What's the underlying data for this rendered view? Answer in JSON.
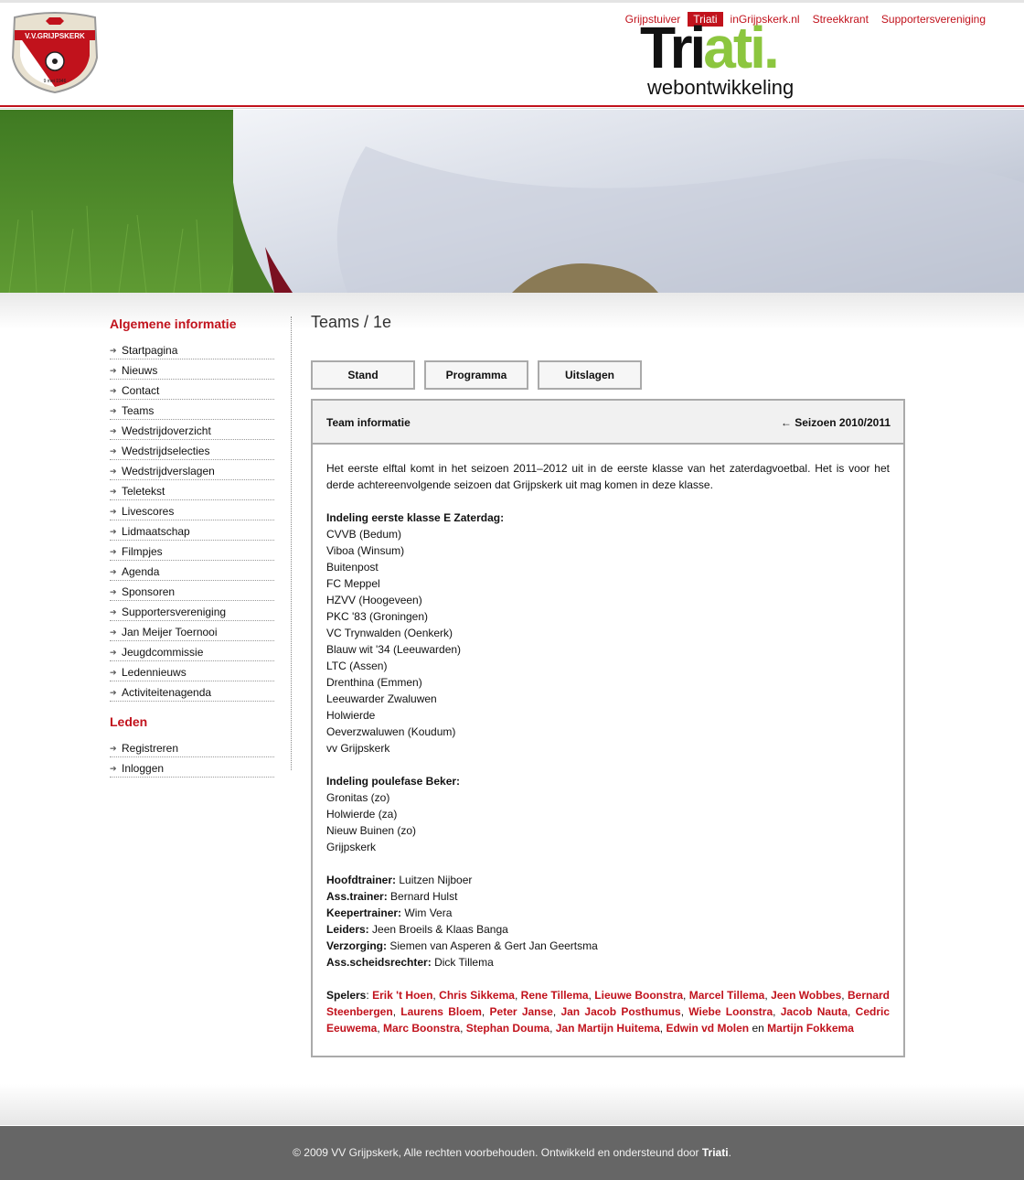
{
  "brand": {
    "club_name": "V.V.GRIJPSKERK",
    "founded": "9 mei 1946"
  },
  "topnav": [
    {
      "label": "Grijpstuiver",
      "active": false
    },
    {
      "label": "Triati",
      "active": true
    },
    {
      "label": "inGrijpskerk.nl",
      "active": false
    },
    {
      "label": "Streekkrant",
      "active": false
    },
    {
      "label": "Supportersvereniging",
      "active": false
    }
  ],
  "sponsor": {
    "name_part1": "Tri",
    "name_part2": "ati.",
    "tagline": "webontwikkeling"
  },
  "sidebar": {
    "section1_title": "Algemene informatie",
    "section1_items": [
      "Startpagina",
      "Nieuws",
      "Contact",
      "Teams",
      "Wedstrijdoverzicht",
      "Wedstrijdselecties",
      "Wedstrijdverslagen",
      "Teletekst",
      "Livescores",
      "Lidmaatschap",
      "Filmpjes",
      "Agenda",
      "Sponsoren",
      "Supportersvereniging",
      "Jan Meijer Toernooi",
      "Jeugdcommissie",
      "Ledennieuws",
      "Activiteitenagenda"
    ],
    "section2_title": "Leden",
    "section2_items": [
      "Registreren",
      "Inloggen"
    ]
  },
  "page_title": "Teams / 1e",
  "tabs": {
    "stand": "Stand",
    "programma": "Programma",
    "uitslagen": "Uitslagen"
  },
  "panel": {
    "header_label": "Team informatie",
    "season_link": "← Seizoen 2010/2011",
    "intro": "Het eerste elftal komt in het seizoen 2011–2012 uit in de eerste klasse van het zaterdagvoetbal. Het is voor het derde achtereenvolgende seizoen dat Grijpskerk uit mag komen in deze klasse.",
    "division_title": "Indeling eerste klasse E Zaterdag:",
    "division": [
      "CVVB (Bedum)",
      "Viboa (Winsum)",
      "Buitenpost",
      "FC Meppel",
      "HZVV (Hoogeveen)",
      "PKC '83 (Groningen)",
      "VC Trynwalden (Oenkerk)",
      "Blauw wit '34 (Leeuwarden)",
      "LTC (Assen)",
      "Drenthina (Emmen)",
      "Leeuwarder Zwaluwen",
      "Holwierde",
      "Oeverzwaluwen (Koudum)",
      "vv Grijpskerk"
    ],
    "cup_title": "Indeling poulefase Beker:",
    "cup": [
      "Gronitas (zo)",
      "Holwierde (za)",
      "Nieuw Buinen (zo)",
      "Grijpskerk"
    ],
    "staff": [
      {
        "role": "Hoofdtrainer:",
        "name": "Luitzen Nijboer"
      },
      {
        "role": "Ass.trainer:",
        "name": "Bernard Hulst"
      },
      {
        "role": "Keepertrainer:",
        "name": "Wim Vera"
      },
      {
        "role": "Leiders:",
        "name": "Jeen Broeils & Klaas Banga"
      },
      {
        "role": "Verzorging:",
        "name": "Siemen van Asperen & Gert Jan Geertsma"
      },
      {
        "role": "Ass.scheidsrechter:",
        "name": "Dick Tillema"
      }
    ],
    "players_label": "Spelers",
    "players": [
      "Erik 't Hoen",
      "Chris Sikkema",
      "Rene Tillema",
      "Lieuwe Boonstra",
      "Marcel Tillema",
      "Jeen Wobbes",
      "Bernard Steenbergen",
      "Laurens Bloem",
      "Peter Janse",
      "Jan Jacob Posthumus",
      "Wiebe Loonstra",
      "Jacob Nauta",
      "Cedric Eeuwema",
      "Marc Boonstra",
      "Stephan Douma",
      "Jan Martijn Huitema",
      "Edwin vd Molen",
      "Martijn Fokkema"
    ],
    "players_conjunction": "en"
  },
  "footer": {
    "text": "© 2009 VV Grijpskerk, Alle rechten voorbehouden. Ontwikkeld en ondersteund door ",
    "link": "Triati",
    "end": "."
  },
  "colors": {
    "accent": "#c1121c",
    "sponsor_green": "#8cc63f",
    "footer_bg": "#666666"
  }
}
